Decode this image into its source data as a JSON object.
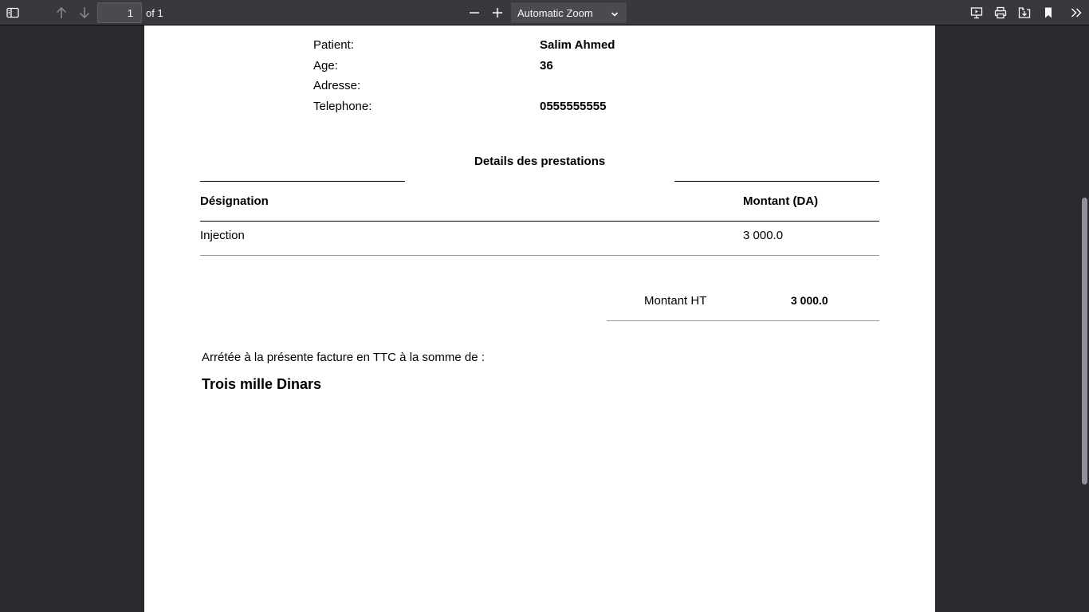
{
  "toolbar": {
    "page_number": "1",
    "page_total_label": "of 1",
    "zoom_label": "Automatic Zoom",
    "icons": [
      "sidebar-toggle-icon",
      "previous-page-icon",
      "next-page-icon",
      "zoom-out-icon",
      "zoom-in-icon",
      "presentation-mode-icon",
      "print-icon",
      "save-icon",
      "bookmark-icon",
      "tools-icon"
    ]
  },
  "patient": {
    "patient_label": "Patient:",
    "patient_value": "Salim Ahmed",
    "age_label": "Age:",
    "age_value": "36",
    "address_label": "Adresse:",
    "address_value": "",
    "phone_label": "Telephone:",
    "phone_value": "0555555555"
  },
  "details": {
    "title": "Details des prestations",
    "columns": [
      "Désignation",
      "Montant (DA)"
    ],
    "rows": [
      {
        "designation": "Injection",
        "amount": "3 000.0"
      }
    ]
  },
  "totals": {
    "ht_label": "Montant HT",
    "ht_value": "3 000.0"
  },
  "summary": {
    "sentence": "Arrétée à la présente facture en TTC à la somme de :",
    "amount_words": "Trois mille Dinars"
  },
  "colors": {
    "toolbar_bg": "#38383d",
    "viewer_bg": "#2a2a2e",
    "page_bg": "#ffffff"
  }
}
